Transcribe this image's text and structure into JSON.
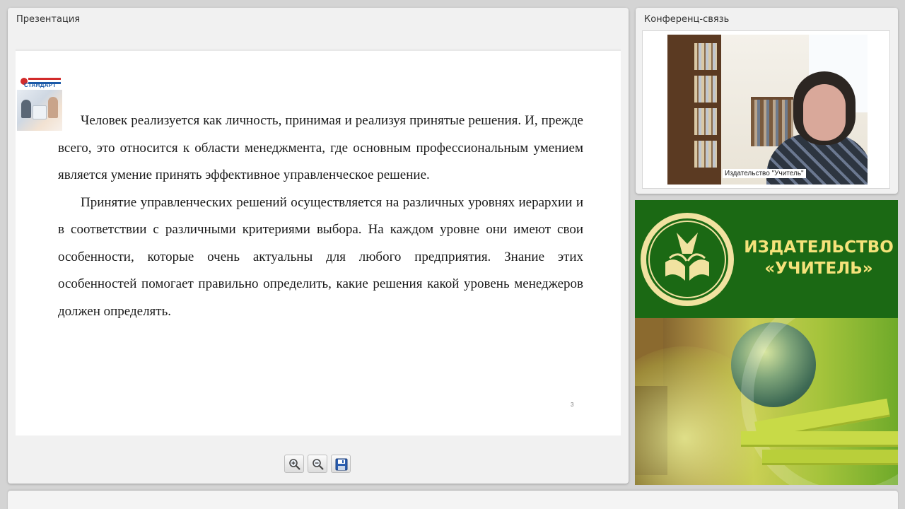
{
  "presentation": {
    "title": "Презентация",
    "slide": {
      "logo_text": "СТАНДАРТ",
      "paragraphs": [
        "Человек реализуется как личность, принимая и реализуя принятые решения. И, прежде всего, это относится к области менеджмента, где основным профессиональным умением является умение принять эффективное управленческое решение.",
        "Принятие управленческих решений осуществляется на различных уровнях иерархии и в соответствии с различными критериями выбора. На каждом уровне они имеют свои особенности, которые очень актуальны для любого предприятия. Знание этих особенностей помогает правильно определить, какие решения какой уровень менеджеров должен определять."
      ],
      "page_number": "3"
    },
    "toolbar": {
      "zoom_in_icon": "zoom-in-icon",
      "zoom_out_icon": "zoom-out-icon",
      "save_icon": "floppy-disk-icon"
    }
  },
  "conference": {
    "title": "Конференц-связь",
    "video_label": "Издательство \"Учитель\""
  },
  "brand": {
    "line1": "ИЗДАТЕЛЬСТВО",
    "line2": "«УЧИТЕЛЬ»",
    "colors": {
      "green": "#1b6914",
      "gold": "#f5e27a"
    }
  }
}
